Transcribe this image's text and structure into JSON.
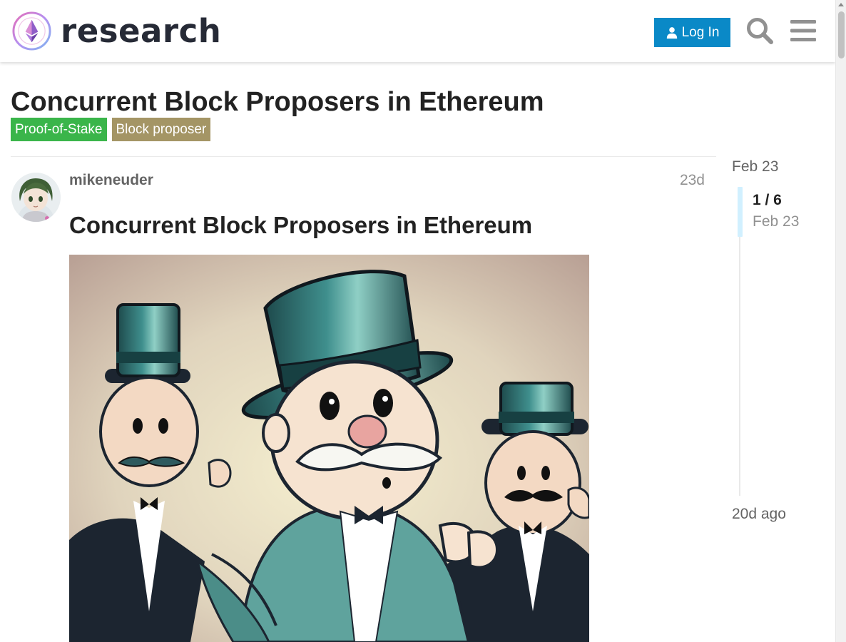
{
  "header": {
    "logo_text": "research",
    "login_label": "Log In",
    "search_icon": "search-icon",
    "menu_icon": "hamburger-menu-icon",
    "brand_color": "#0a89c7"
  },
  "topic": {
    "title": "Concurrent Block Proposers in Ethereum",
    "tags": [
      {
        "label": "Proof-of-Stake",
        "color": "#3ab54a"
      },
      {
        "label": "Block proposer",
        "color": "#a49565"
      }
    ]
  },
  "post": {
    "username": "mikeneuder",
    "age": "23d",
    "heading": "Concurrent Block Proposers in Ethereum",
    "image_description_icon": "illustration-image"
  },
  "timeline": {
    "start_date": "Feb 23",
    "position": "1 / 6",
    "position_date": "Feb 23",
    "end_label": "20d ago"
  }
}
